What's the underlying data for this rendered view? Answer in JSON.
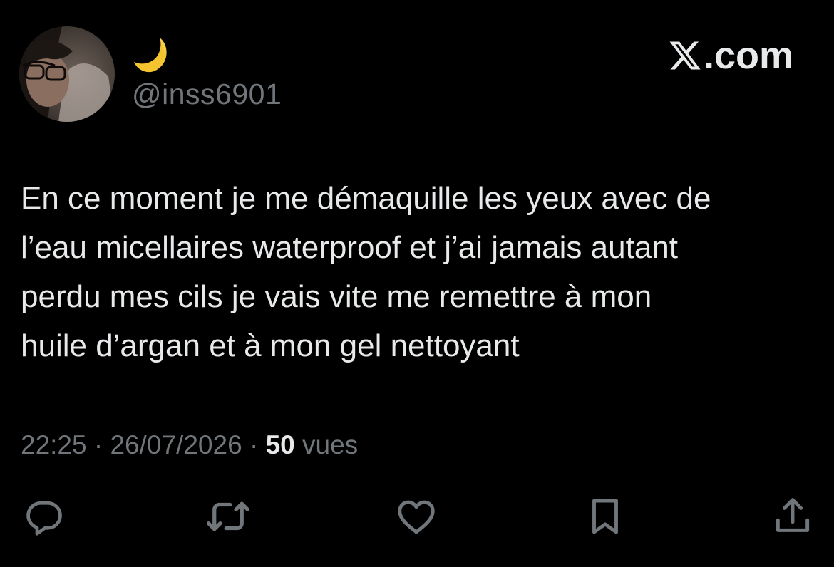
{
  "header": {
    "display_name_icon": "crescent-moon-emoji",
    "handle": "@inss6901",
    "brand": ".com",
    "brand_icon": "x-logo-icon"
  },
  "tweet": {
    "lines": [
      "En ce moment je me démaquille les yeux avec de",
      "l’eau micellaires waterproof et j’ai jamais autant",
      "perdu mes cils je vais vite me remettre à mon",
      "huile d’argan et à mon gel nettoyant"
    ]
  },
  "meta": {
    "time": "22:25",
    "separator": " · ",
    "date": "26/07/2026",
    "views_count": "50",
    "views_label": " vues"
  },
  "actions": [
    {
      "name": "reply",
      "icon": "reply-icon"
    },
    {
      "name": "retweet",
      "icon": "retweet-icon"
    },
    {
      "name": "like",
      "icon": "heart-icon"
    },
    {
      "name": "bookmark",
      "icon": "bookmark-icon"
    },
    {
      "name": "share",
      "icon": "share-icon"
    }
  ],
  "colors": {
    "background": "#000000",
    "text_primary": "#e7e9ea",
    "text_secondary": "#71767b",
    "moon": "#f4c430"
  }
}
